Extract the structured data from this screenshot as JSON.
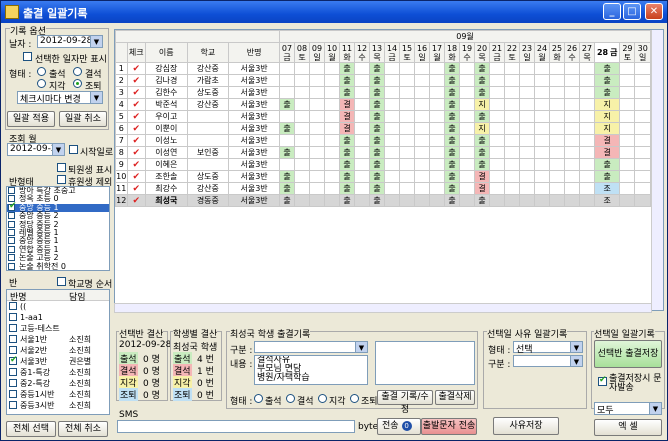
{
  "window": {
    "title": "출결 일괄기록"
  },
  "options": {
    "group_label": "기록 옵션",
    "date_label": "날자 :",
    "date_value": "2012-09-28",
    "only_selected_label": "선택한 일자만 표시",
    "status_label": "형태 :",
    "status_attend": "출석",
    "status_absent": "결석",
    "status_late": "지각",
    "status_leave": "조퇴",
    "check_change_value": "체크시마다 변경",
    "apply_button": "일괄 적용",
    "cancel_button": "일괄 취소"
  },
  "query": {
    "month_label": "조회 월",
    "month_value": "2012-09-28",
    "start_label": "시작일로",
    "show_retired_label": "퇴원생 표시",
    "exclude_retired_label": "휴원생 제외",
    "class_state_label": "반형태"
  },
  "class_list": [
    {
      "label": "방아 특강 초중고",
      "checked": false,
      "selected": false
    },
    {
      "label": "정옥 초등 0",
      "checked": false,
      "selected": false
    },
    {
      "label": "중앙 중등 1",
      "checked": true,
      "selected": true
    },
    {
      "label": "중앙 중등 2",
      "checked": false,
      "selected": false
    },
    {
      "label": "정당 중등 2",
      "checked": false,
      "selected": false
    },
    {
      "label": "레벨 중등 1",
      "checked": false,
      "selected": false
    },
    {
      "label": "중앙 중등 1",
      "checked": false,
      "selected": false
    },
    {
      "label": "연합 중등 1",
      "checked": false,
      "selected": false
    },
    {
      "label": "논술 고등 2",
      "checked": false,
      "selected": false
    },
    {
      "label": "논술 취학전 0",
      "checked": false,
      "selected": false
    }
  ],
  "ban": {
    "label": "반",
    "show_school_label": "학교명 순서",
    "col_name": "반명",
    "col_teacher": "담임",
    "rows": [
      {
        "name": "((",
        "teacher": "",
        "checked": false
      },
      {
        "name": "1-aa1",
        "teacher": "",
        "checked": false
      },
      {
        "name": "고등-테스트",
        "teacher": "",
        "checked": false
      },
      {
        "name": "서울1반",
        "teacher": "소진희",
        "checked": false
      },
      {
        "name": "서울2반",
        "teacher": "소진희",
        "checked": false
      },
      {
        "name": "서울3반",
        "teacher": "권은별",
        "checked": true
      },
      {
        "name": "중1-특강",
        "teacher": "소진희",
        "checked": false
      },
      {
        "name": "중2-특강",
        "teacher": "소진희",
        "checked": false
      },
      {
        "name": "중등1시반",
        "teacher": "소진희",
        "checked": false
      },
      {
        "name": "중등3시반",
        "teacher": "소진희",
        "checked": false
      }
    ],
    "select_all_button": "전체 선택",
    "cancel_all_button": "전체 취소"
  },
  "grid": {
    "month_label": "09월",
    "headers": [
      "체크",
      "이름",
      "학교",
      "반명"
    ],
    "days": [
      {
        "d": "07",
        "w": "금"
      },
      {
        "d": "08",
        "w": "토"
      },
      {
        "d": "09",
        "w": "일"
      },
      {
        "d": "10",
        "w": "월"
      },
      {
        "d": "11",
        "w": "화"
      },
      {
        "d": "12",
        "w": "수"
      },
      {
        "d": "13",
        "w": "목"
      },
      {
        "d": "14",
        "w": "금"
      },
      {
        "d": "15",
        "w": "토"
      },
      {
        "d": "16",
        "w": "일"
      },
      {
        "d": "17",
        "w": "월"
      },
      {
        "d": "18",
        "w": "화"
      },
      {
        "d": "19",
        "w": "수"
      },
      {
        "d": "20",
        "w": "목"
      },
      {
        "d": "21",
        "w": "금"
      },
      {
        "d": "22",
        "w": "토"
      },
      {
        "d": "23",
        "w": "일"
      },
      {
        "d": "24",
        "w": "월"
      },
      {
        "d": "25",
        "w": "화"
      },
      {
        "d": "26",
        "w": "수"
      },
      {
        "d": "27",
        "w": "목"
      },
      {
        "d": "28",
        "w": "금"
      },
      {
        "d": "29",
        "w": "토"
      },
      {
        "d": "30",
        "w": "일"
      }
    ],
    "rows": [
      {
        "no": "1",
        "name": "강심장",
        "school": "강산중",
        "class": "서울3반",
        "cells": {
          "4": "출",
          "6": "출",
          "11": "출",
          "13": "출",
          "21": "출"
        }
      },
      {
        "no": "2",
        "name": "김나경",
        "school": "가람초",
        "class": "서울3반",
        "cells": {
          "4": "출",
          "6": "출",
          "11": "출",
          "13": "출",
          "21": "출"
        }
      },
      {
        "no": "3",
        "name": "김한수",
        "school": "상도중",
        "class": "서울3반",
        "cells": {
          "4": "출",
          "6": "출",
          "11": "출",
          "13": "출",
          "21": "출"
        }
      },
      {
        "no": "4",
        "name": "박준석",
        "school": "강산중",
        "class": "서울3반",
        "cells": {
          "0": "출",
          "4": "결",
          "6": "출",
          "11": "출",
          "13": "지",
          "21": "지"
        }
      },
      {
        "no": "5",
        "name": "우이고",
        "school": "",
        "class": "서울3반",
        "cells": {
          "4": "결",
          "6": "출",
          "11": "출",
          "13": "출",
          "21": "지"
        }
      },
      {
        "no": "6",
        "name": "이뿐이",
        "school": "",
        "class": "서울3반",
        "cells": {
          "0": "출",
          "4": "결",
          "6": "출",
          "11": "출",
          "13": "지",
          "21": "지"
        }
      },
      {
        "no": "7",
        "name": "이성노",
        "school": "",
        "class": "서울3반",
        "cells": {
          "4": "출",
          "6": "출",
          "11": "출",
          "13": "출",
          "21": "결"
        }
      },
      {
        "no": "8",
        "name": "이성연",
        "school": "보인중",
        "class": "서울3반",
        "cells": {
          "0": "출",
          "4": "출",
          "6": "출",
          "11": "출",
          "13": "출",
          "21": "결"
        }
      },
      {
        "no": "9",
        "name": "이혜은",
        "school": "",
        "class": "서울3반",
        "cells": {
          "4": "출",
          "6": "출",
          "11": "출",
          "13": "출",
          "21": "출"
        }
      },
      {
        "no": "10",
        "name": "조한솔",
        "school": "상도중",
        "class": "서울3반",
        "cells": {
          "0": "출",
          "4": "출",
          "6": "출",
          "11": "출",
          "13": "결",
          "21": "출"
        }
      },
      {
        "no": "11",
        "name": "최강수",
        "school": "강산중",
        "class": "서울3반",
        "cells": {
          "0": "출",
          "4": "출",
          "6": "출",
          "11": "출",
          "13": "결",
          "21": "조"
        }
      },
      {
        "no": "12",
        "name": "최성국",
        "school": "경동중",
        "class": "서울3반",
        "cells": {
          "0": "출",
          "4": "출",
          "6": "출",
          "11": "출",
          "13": "출",
          "21": "조"
        }
      }
    ]
  },
  "summary": {
    "selected_label": "선택반 결산",
    "selected_date": "2012-09-28",
    "student_label": "학생별 결산",
    "student_name": "최성국 학생",
    "attend": "출석",
    "absent": "결석",
    "late": "지각",
    "leave": "조퇴",
    "cls_attend": "0 명",
    "cls_absent": "0 명",
    "cls_late": "0 명",
    "cls_leave": "0 명",
    "stu_attend": "4 번",
    "stu_absent": "1 번",
    "stu_late": "0 번",
    "stu_leave": "0 번"
  },
  "record": {
    "title": "최성국 학생 출결기록",
    "type_label": "구분 :",
    "content_label": "내용 :",
    "content_lines": [
      "결석사유",
      "부모님 면담",
      "병원/자택학습"
    ],
    "status_label": "형태 :",
    "s1": "출석",
    "s2": "결석",
    "s3": "지각",
    "s4": "조퇴",
    "save_button": "출결 기록/수정",
    "delete_button": "출결삭제"
  },
  "reason": {
    "title": "선택일 사유 일괄기록",
    "type_label": "형태 :",
    "type_value": "선택",
    "cat_label": "구분 :",
    "save_button": "사유저장"
  },
  "selected_day": {
    "title": "선택일 일괄기록",
    "save_button": "선택반 출결저장",
    "auto_check_label": "출결저장시 문자발송",
    "mode_value": "모두",
    "excel_button": "엑 셀"
  },
  "sms": {
    "label": "SMS",
    "unit": "byte",
    "send_button": "전송",
    "send_badge": "0",
    "attend_send_button": "출발문자 전송"
  }
}
